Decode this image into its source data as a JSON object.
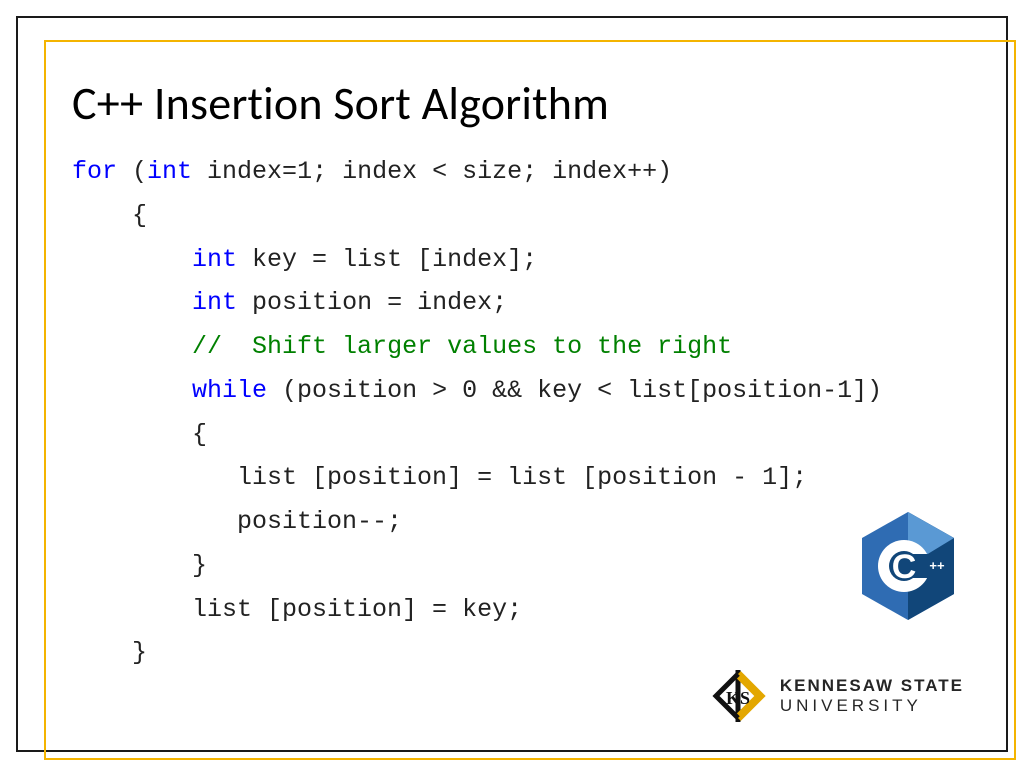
{
  "slide": {
    "title": "C++ Insertion Sort Algorithm"
  },
  "code": {
    "l01a": "for",
    "l01b": " (",
    "l01c": "int",
    "l01d": " index=1; index < size; index++)",
    "l02": "    {",
    "l03a": "        ",
    "l03b": "int",
    "l03c": " key = list [index];",
    "l04a": "        ",
    "l04b": "int",
    "l04c": " position = index;",
    "l05a": "        ",
    "l05b": "//  Shift larger values to the right",
    "l06a": "        ",
    "l06b": "while",
    "l06c": " (position > 0 && key < list[position-1])",
    "l07": "        {",
    "l08": "           list [position] = list [position - 1];",
    "l09": "           position--;",
    "l10": "        }",
    "l11": "        list [position] = key;",
    "l12": "    }"
  },
  "logo": {
    "cpp_label": "C",
    "cpp_plus": "++"
  },
  "university": {
    "line1": "KENNESAW STATE",
    "line2": "UNIVERSITY",
    "monogram": "KS"
  }
}
